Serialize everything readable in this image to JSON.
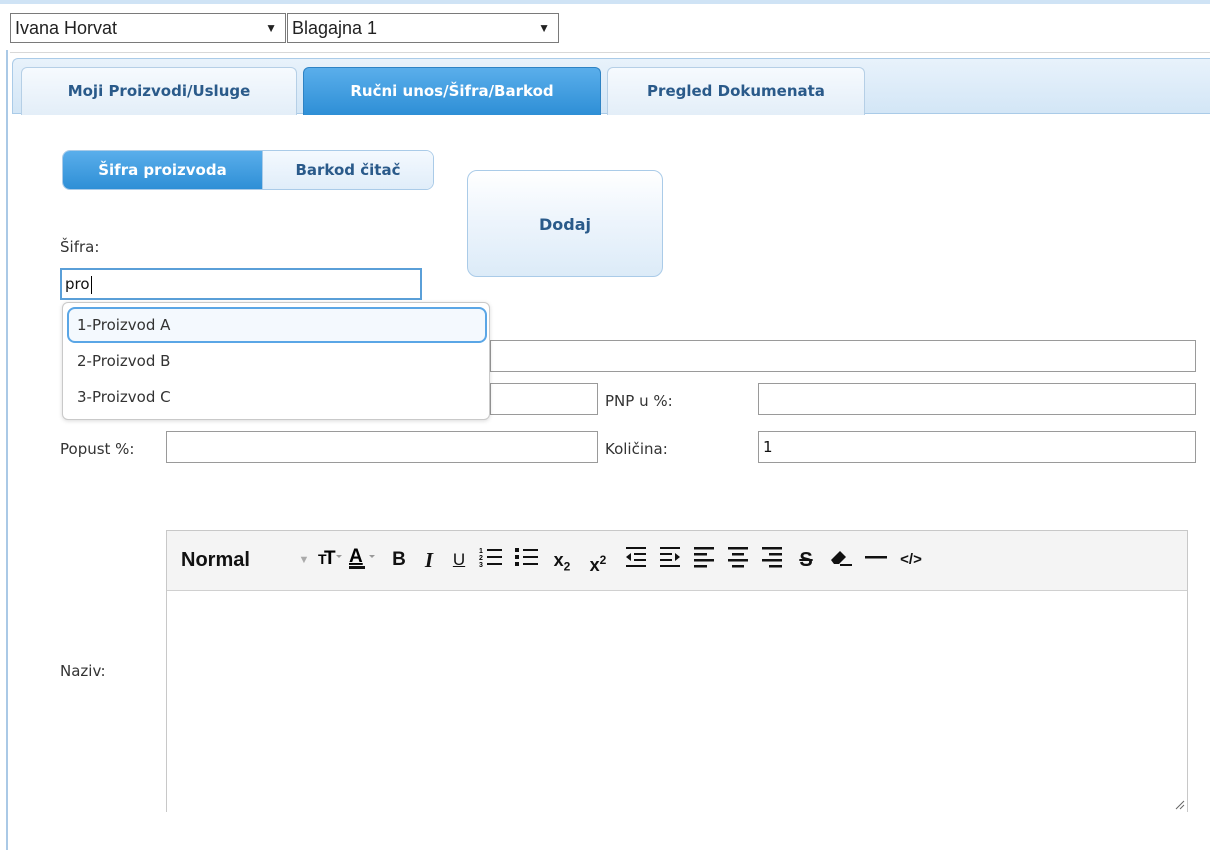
{
  "header": {
    "user_select": "Ivana Horvat",
    "register_select": "Blagajna 1"
  },
  "tabs": [
    {
      "label": "Moji Proizvodi/Usluge",
      "active": false
    },
    {
      "label": "Ručni unos/Šifra/Barkod",
      "active": true
    },
    {
      "label": "Pregled Dokumenata",
      "active": false
    }
  ],
  "mode": {
    "sifra_label": "Šifra proizvoda",
    "barkod_label": "Barkod čitač"
  },
  "form": {
    "dodaj_label": "Dodaj",
    "sifra_label": "Šifra:",
    "sifra_value": "pro",
    "pnp_label": "PNP u %:",
    "pnp_value": "",
    "popust_label": "Popust %:",
    "popust_value": "",
    "kolicina_label": "Količina:",
    "kolicina_value": "1",
    "naziv_label": "Naziv:"
  },
  "autocomplete": {
    "items": [
      "1-Proizvod A",
      "2-Proizvod B",
      "3-Proizvod C"
    ],
    "highlighted_index": 0
  },
  "editor": {
    "format_select": "Normal",
    "toolbar_icons": [
      "font-size-icon",
      "font-color-icon",
      "bold-icon",
      "italic-icon",
      "underline-icon",
      "ordered-list-icon",
      "unordered-list-icon",
      "subscript-icon",
      "superscript-icon",
      "outdent-icon",
      "indent-icon",
      "align-left-icon",
      "align-center-icon",
      "align-right-icon",
      "strikethrough-icon",
      "eraser-icon",
      "horizontal-rule-icon",
      "code-view-icon"
    ]
  },
  "colors": {
    "accent": "#2e8fd6",
    "tab_bg": "#d3e6f6",
    "focus_border": "#5a9fd8"
  }
}
